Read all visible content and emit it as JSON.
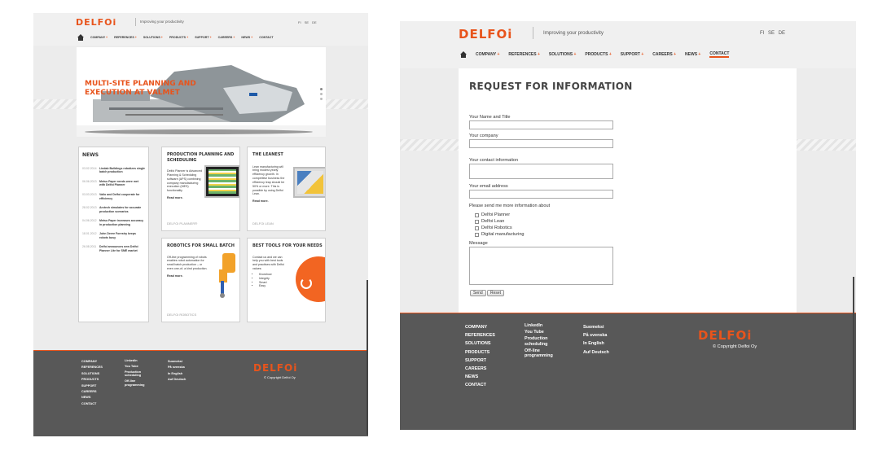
{
  "brand": {
    "logo": "DELFOi",
    "tagline": "Improving your productivity",
    "accent": "#e8541c"
  },
  "languages": {
    "fi": "FI",
    "se": "SE",
    "de": "DE"
  },
  "nav": [
    "COMPANY",
    "REFERENCES",
    "SOLUTIONS",
    "PRODUCTS",
    "SUPPORT",
    "CAREERS",
    "NEWS",
    "CONTACT"
  ],
  "hero": {
    "title_line1": "MULTI-SITE PLANNING AND",
    "title_line2": "EXECUTION AT VALMET"
  },
  "news": {
    "heading": "NEWS",
    "items": [
      {
        "date": "03.02.2014",
        "title": "Lindab Buildings robotizes single batch production"
      },
      {
        "date": "06.06.2013",
        "title": "Metso Paper needs were met with Delfoi Planner"
      },
      {
        "date": "03.03.2013",
        "title": "Valio and Delfoi cooperate for efficiency"
      },
      {
        "date": "28.02.2013",
        "title": "Arctech simulates for accurate production scenarios"
      },
      {
        "date": "04.06.2012",
        "title": "Metso Paper increases accuracy in production planning"
      },
      {
        "date": "18.01.2012",
        "title": "John Deere Forestry keeps robots busy"
      },
      {
        "date": "26.08.2011",
        "title": "Delfoi announces new Delfoi Planner Lite for SME market"
      }
    ]
  },
  "cards": {
    "planning": {
      "title1": "PRODUCTION PLANNING AND",
      "title2": "SCHEDULING",
      "text": "Delfoi Planner is Advanced Planning & Scheduling software (APS) combining company manufacturing execution (MES) functionality",
      "more": "Read more.",
      "product": "DELFOi PLANNER®"
    },
    "leanest": {
      "title": "THE LEANEST",
      "text": "Lean manufacturing will bring modest yearly efficiency growth. In competitive business the efficiency leap should be 50% or more. This is possible by using Delfoi Lean.",
      "more": "Read more.",
      "product": "DELFOi LEAN"
    },
    "robotics": {
      "title": "ROBOTICS FOR SMALL BATCH",
      "text": "Off-line programming of robots enables robot automation for small batch production – or even one-of- a kind production.",
      "more": "Read more.",
      "product": "DELFOi ROBOTICS"
    },
    "tools": {
      "title": "BEST TOOLS FOR YOUR NEEDS",
      "text": "Contact us and we can help you with best tools and practises with Delfoi values:",
      "values": [
        "Knowhow",
        "Integrity",
        "Smart",
        "Easy"
      ]
    }
  },
  "footer": {
    "col1": [
      "COMPANY",
      "REFERENCES",
      "SOLUTIONS",
      "PRODUCTS",
      "SUPPORT",
      "CAREERS",
      "NEWS",
      "CONTACT"
    ],
    "col2": [
      "LinkedIn",
      "You Tube",
      "Production scheduling",
      "Off-line programming"
    ],
    "col3": [
      "Suomeksi",
      "På svenska",
      "In English",
      "Auf Deutsch"
    ],
    "copyright": "© Copyright Delfoi Oy"
  },
  "form": {
    "title": "REQUEST FOR INFORMATION",
    "name_label": "Your Name and Title",
    "company_label": "Your company",
    "contact_label": "Your contact information",
    "email_label": "Your email address",
    "interest_label": "Please send me more information about",
    "options": [
      "Delfoi Planner",
      "Delfoi Lean",
      "Delfoi Robotics",
      "Digital manufacturing"
    ],
    "message_label": "Message",
    "send": "Send",
    "reset": "Reset"
  }
}
